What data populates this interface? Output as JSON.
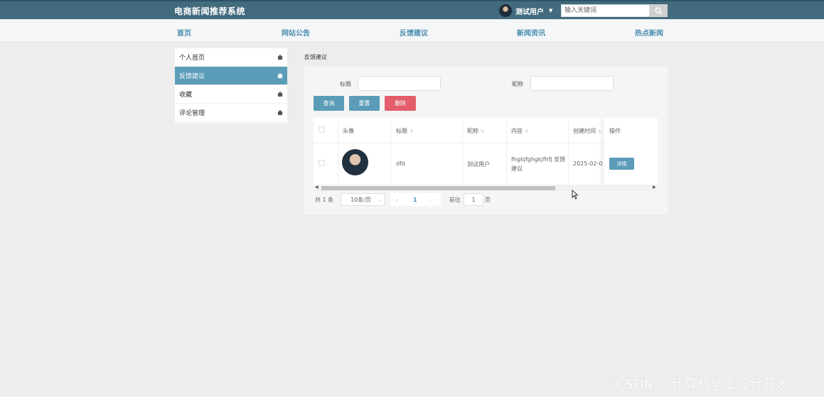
{
  "header": {
    "site_title": "电商新闻推荐系统",
    "user_name": "测试用户",
    "search_placeholder": "输入关键词"
  },
  "nav": [
    "首页",
    "网站公告",
    "反馈建议",
    "新闻资讯",
    "热点新闻"
  ],
  "sidebar": [
    {
      "label": "个人首页",
      "active": false
    },
    {
      "label": "反馈建议",
      "active": true
    },
    {
      "label": "收藏",
      "active": false
    },
    {
      "label": "评论管理",
      "active": false
    }
  ],
  "breadcrumb": "反馈建议",
  "filters": {
    "title_label": "标题",
    "nickname_label": "昵称"
  },
  "buttons": {
    "query": "查询",
    "reset": "重置",
    "delete": "删除",
    "detail": "详情"
  },
  "colors": {
    "header_bg": "#426b7d",
    "accent": "#5b9cb8",
    "danger": "#e35d6a"
  },
  "table": {
    "columns": [
      "头像",
      "标题",
      "昵称",
      "内容",
      "创建时间",
      "操作"
    ],
    "rows": [
      {
        "title": "dfd",
        "nickname": "测试用户",
        "content": "fhgkjfghgkjfhfj 反馈建议",
        "created": "2025-02-0"
      }
    ]
  },
  "pagination": {
    "total": "共 1 条",
    "page_size": "10条/页",
    "current_page": "1",
    "goto_label": "前往",
    "goto_value": "1",
    "page_suffix": "页"
  },
  "watermark": "CSDN @计算机毕业设计开发"
}
